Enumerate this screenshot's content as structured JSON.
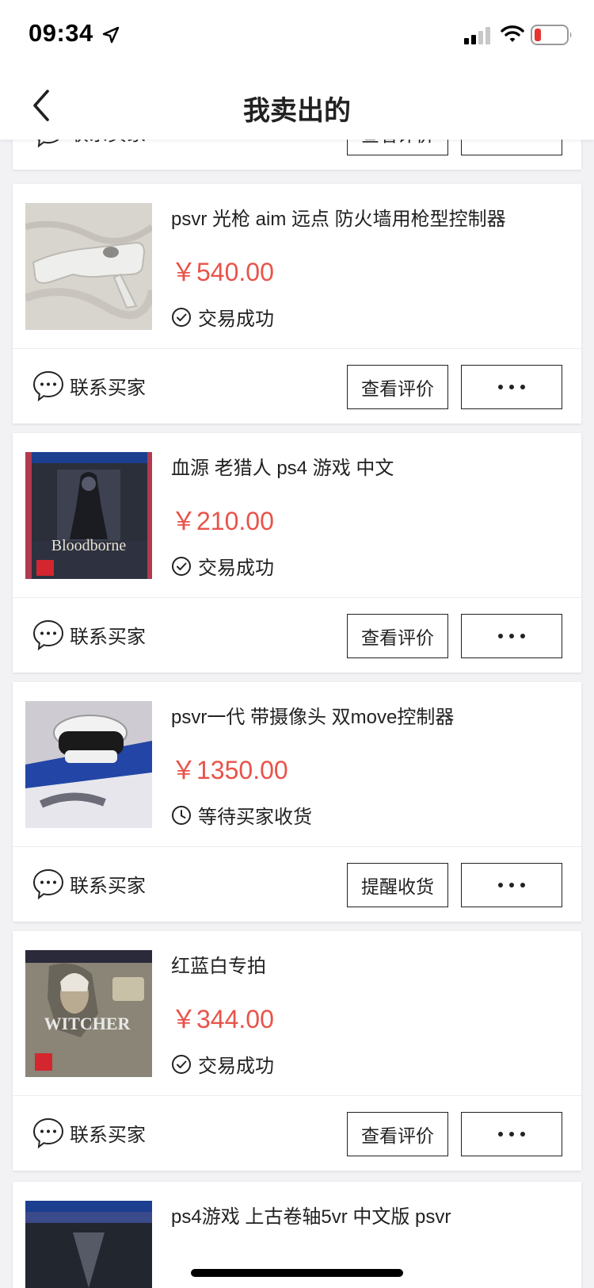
{
  "status_bar": {
    "time": "09:34"
  },
  "nav": {
    "title": "我卖出的",
    "back_icon": "chevron-left-icon"
  },
  "orders": [
    {
      "title": "",
      "price": "",
      "status": "",
      "contact_label": "联系买家",
      "action_label": "查看评价"
    },
    {
      "title": "psvr 光枪 aim 远点 防火墙用枪型控制器",
      "price": "￥540.00",
      "status": "交易成功",
      "status_icon": "check-circle-icon",
      "contact_label": "联系买家",
      "action_label": "查看评价"
    },
    {
      "title": "血源 老猎人 ps4 游戏 中文",
      "price": "￥210.00",
      "status": "交易成功",
      "status_icon": "check-circle-icon",
      "contact_label": "联系买家",
      "action_label": "查看评价"
    },
    {
      "title": "psvr一代 带摄像头 双move控制器",
      "price": "￥1350.00",
      "status": "等待买家收货",
      "status_icon": "clock-icon",
      "contact_label": "联系买家",
      "action_label": "提醒收货"
    },
    {
      "title": "红蓝白专拍",
      "price": "￥344.00",
      "status": "交易成功",
      "status_icon": "check-circle-icon",
      "contact_label": "联系买家",
      "action_label": "查看评价"
    },
    {
      "title": "ps4游戏 上古卷轴5vr 中文版 psvr",
      "price": "",
      "status": "",
      "contact_label": "",
      "action_label": ""
    }
  ],
  "colors": {
    "price": "#e8534a",
    "background": "#f2f2f5",
    "card": "#ffffff"
  }
}
